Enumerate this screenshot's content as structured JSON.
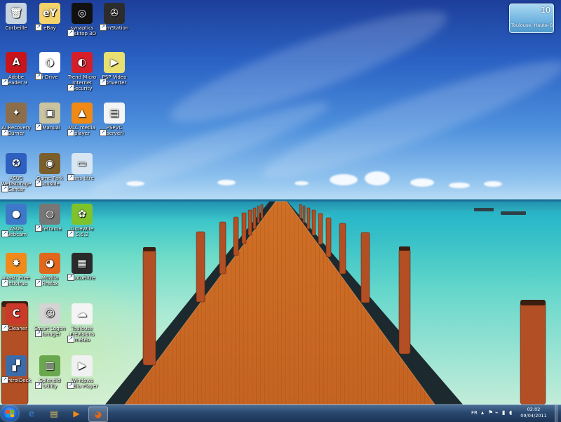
{
  "desktop": {
    "icons": [
      {
        "label": "Corbeille",
        "glyph": "🗑",
        "bg": "#c7d3de"
      },
      {
        "label": "eBay",
        "glyph": "eY",
        "bg": "#f3d36a"
      },
      {
        "label": "synaptics desktop 3D",
        "glyph": "◎",
        "bg": "#111111"
      },
      {
        "label": "RemStation",
        "glyph": "✇",
        "bg": "#2c2c2c"
      },
      {
        "label": "Adobe Reader 9",
        "glyph": "A",
        "bg": "#c8151b"
      },
      {
        "label": "i-Drive",
        "glyph": "◑",
        "bg": "#ffffff"
      },
      {
        "label": "Trend Micro Internet Security",
        "glyph": "◐",
        "bg": "#d41f2a"
      },
      {
        "label": "PSP Video Converter",
        "glyph": "▶",
        "bg": "#e8e070"
      },
      {
        "label": "AI Recovery Burner",
        "glyph": "✦",
        "bg": "#8d6e4a"
      },
      {
        "label": "eManual",
        "glyph": "▣",
        "bg": "#c9c3a0"
      },
      {
        "label": "VLC media player",
        "glyph": "▲",
        "bg": "#f08a14"
      },
      {
        "label": "PSPVC (server)",
        "glyph": "▤",
        "bg": "#f4f4f4"
      },
      {
        "label": "ASUS WebStorage Center",
        "glyph": "✪",
        "bg": "#2f5fbf"
      },
      {
        "label": "Game Park Console",
        "glyph": "◉",
        "bg": "#7a5f2c"
      },
      {
        "label": "Sans titre",
        "glyph": "▭",
        "bg": "#d8e6f3"
      },
      {
        "label": "ASUS Webcam",
        "glyph": "●",
        "bg": "#3e79c9"
      },
      {
        "label": "Lifeframe",
        "glyph": "◍",
        "bg": "#777777"
      },
      {
        "label": "LimeWire 5.6.2",
        "glyph": "✿",
        "bg": "#7fc32c"
      },
      {
        "label": "avast! Free Antivirus",
        "glyph": "✸",
        "bg": "#f08a1a"
      },
      {
        "label": "Mozilla Firefox",
        "glyph": "◕",
        "bg": "#e0671b"
      },
      {
        "label": "PhotoFiltre",
        "glyph": "▦",
        "bg": "#2a2a2a"
      },
      {
        "label": "CCleaner",
        "glyph": "C",
        "bg": "#c93a2a"
      },
      {
        "label": "Smart Logon Manager",
        "glyph": "☺",
        "bg": "#d4d4d4"
      },
      {
        "label": "Toulouse Prévisions météo",
        "glyph": "☁",
        "bg": "#f4f4f4"
      },
      {
        "label": "ControlDeck",
        "glyph": "▞",
        "bg": "#3b6ca9"
      },
      {
        "label": "Splendid Utility",
        "glyph": "▥",
        "bg": "#6aa84f"
      },
      {
        "label": "Windows Media Player",
        "glyph": "▶",
        "bg": "#f1f1f1"
      }
    ]
  },
  "gadget": {
    "temperature": "10",
    "location": "Toulouse, Haute-Ga..."
  },
  "taskbar": {
    "pinned": [
      {
        "name": "internet-explorer",
        "glyph": "e",
        "color": "#3b8fe0"
      },
      {
        "name": "windows-explorer",
        "glyph": "▤",
        "color": "#e6c35a"
      },
      {
        "name": "media-player",
        "glyph": "▶",
        "color": "#f08a14"
      },
      {
        "name": "firefox",
        "glyph": "◕",
        "color": "#e0671b"
      }
    ],
    "language": "FR",
    "time": "02:02",
    "date": "09/04/2011"
  },
  "colors": {
    "taskbar": "#29476e",
    "sky_top": "#1d3f9a",
    "sea": "#3cc6c9",
    "pier": "#c9621f"
  }
}
